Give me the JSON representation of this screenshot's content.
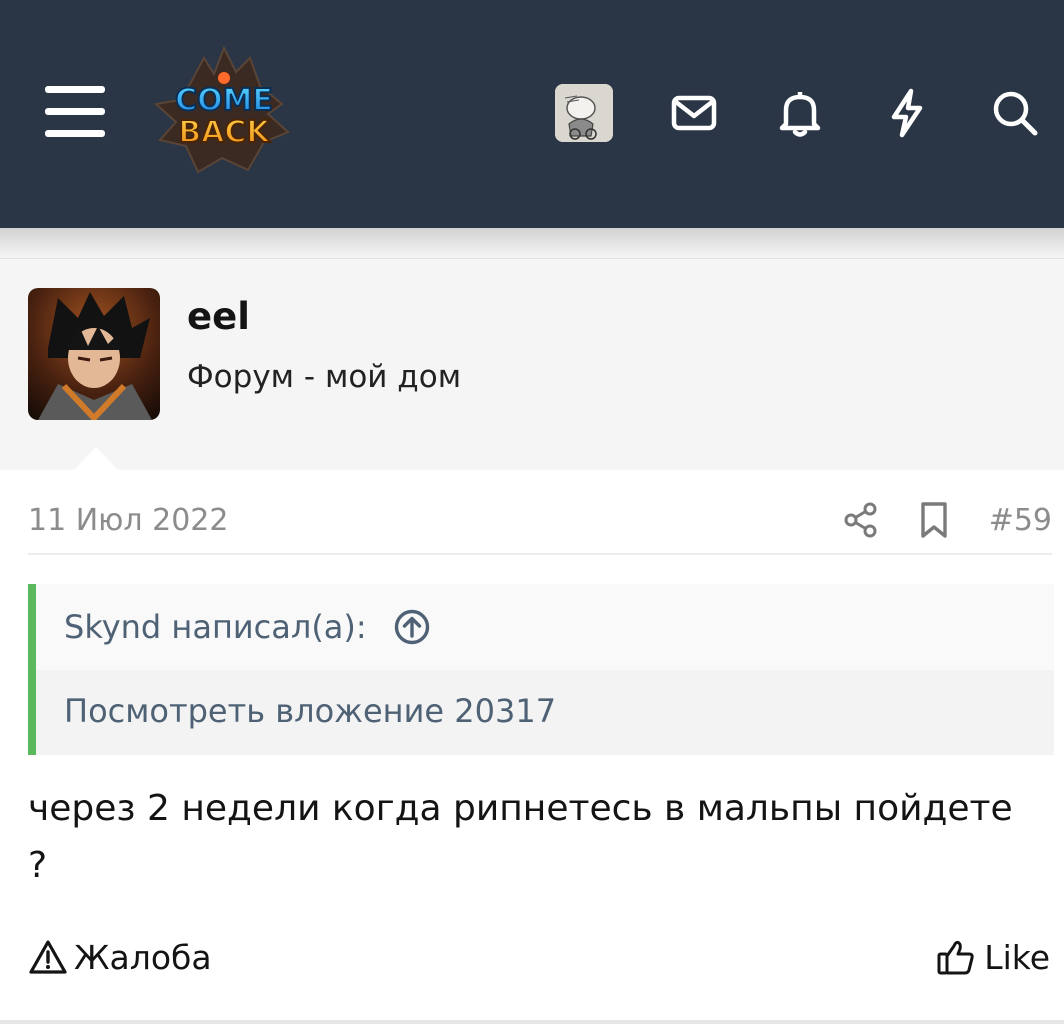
{
  "header": {
    "logo_text_line1": "COME",
    "logo_text_line2": "BACK",
    "icons": [
      "menu-icon",
      "user-avatar",
      "envelope-icon",
      "bell-icon",
      "lightning-icon",
      "search-icon"
    ]
  },
  "post": {
    "author": "eel",
    "author_title": "Форум - мой дом",
    "date": "11 Июл 2022",
    "number": "#59",
    "quote": {
      "author_line": "Skynd написал(а):",
      "body": "Посмотреть вложение 20317"
    },
    "text": "через 2 недели когда рипнетесь в мальпы пойдете ?",
    "actions": {
      "report": "Жалоба",
      "like": "Like"
    }
  },
  "colors": {
    "header_bg": "#2a3646",
    "quote_accent": "#5cb85c",
    "quote_text": "#4f6275",
    "muted": "#8c8c8c"
  }
}
